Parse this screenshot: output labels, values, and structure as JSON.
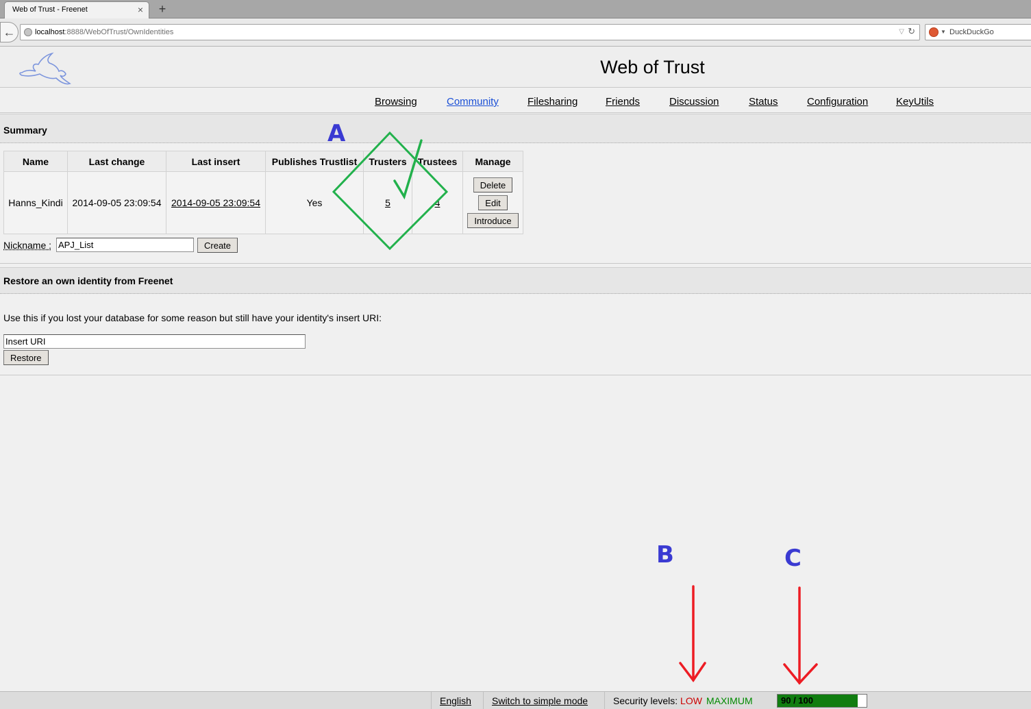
{
  "browser": {
    "tab_title": "Web of Trust - Freenet",
    "tab_close": "×",
    "new_tab": "+",
    "back": "←",
    "url_host": "localhost",
    "url_path": ":8888/WebOfTrust/OwnIdentities",
    "url_dropdown": "▽",
    "url_reload": "↻",
    "search_engine": "DuckDuckGo",
    "search_dropdown": "▼"
  },
  "page": {
    "title": "Web of Trust"
  },
  "menu": [
    {
      "label": "Browsing",
      "active": false
    },
    {
      "label": "Community",
      "active": true
    },
    {
      "label": "Filesharing",
      "active": false
    },
    {
      "label": "Friends",
      "active": false
    },
    {
      "label": "Discussion",
      "active": false
    },
    {
      "label": "Status",
      "active": false
    },
    {
      "label": "Configuration",
      "active": false
    },
    {
      "label": "KeyUtils",
      "active": false
    }
  ],
  "summary": {
    "heading": "Summary",
    "columns": [
      "Name",
      "Last change",
      "Last insert",
      "Publishes Trustlist",
      "Trusters",
      "Trustees",
      "Manage"
    ],
    "row": {
      "name": "Hanns_Kindi",
      "last_change": "2014-09-05 23:09:54",
      "last_insert": "2014-09-05 23:09:54",
      "publishes_trustlist": "Yes",
      "trusters": "5",
      "trustees": "4"
    },
    "buttons": {
      "delete": "Delete",
      "edit": "Edit",
      "introduce": "Introduce"
    },
    "nickname_label": "Nickname :",
    "nickname_value": "APJ_List",
    "create_label": "Create"
  },
  "restore": {
    "heading": "Restore an own identity from Freenet",
    "description": "Use this if you lost your database for some reason but still have your identity's insert URI:",
    "uri_value": "Insert URI",
    "restore_label": "Restore"
  },
  "footer": {
    "language": "English",
    "mode_switch": "Switch to simple mode",
    "security_label": "Security levels:",
    "security_network": "LOW",
    "security_physical": "MAXIMUM",
    "progress_text": "90 / 100",
    "progress_fraction": 0.9
  },
  "annotations": {
    "a": "A",
    "b": "B",
    "c": "C"
  },
  "colors": {
    "active_link": "#1a4fd6",
    "security_low": "#cc0000",
    "security_max": "#008a00",
    "progress_fill": "#107d10",
    "annotation_letters": "#3a3ad2",
    "annotation_checkmark": "#22b14c",
    "annotation_arrows": "#ed1c24"
  }
}
